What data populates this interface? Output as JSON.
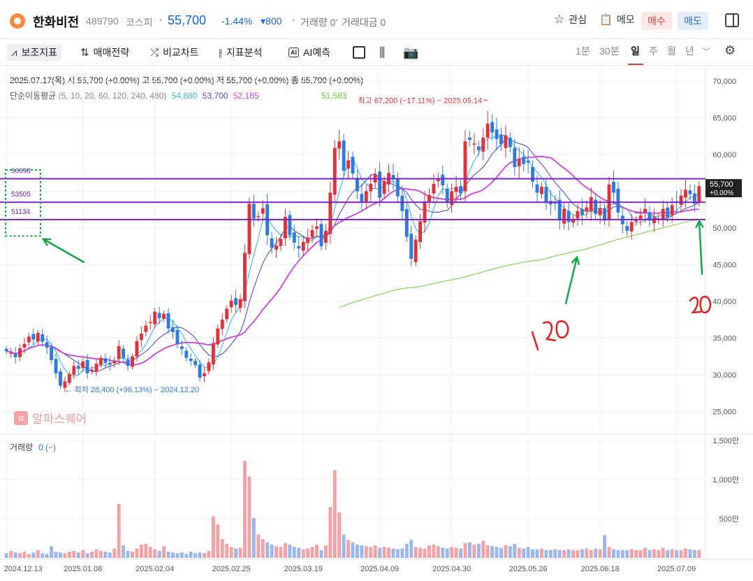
{
  "header": {
    "name": "한화비전",
    "code": "489790",
    "market": "코스피",
    "price": "55,700",
    "change_pct": "-1.44%",
    "change_amt": "▾800",
    "volume": "거래량 0",
    "turnover": "거래대금 0",
    "fav": "관심",
    "memo": "메모",
    "buy": "매수",
    "sell": "매도"
  },
  "toolbar": {
    "indicators": "보조지표",
    "strategy": "매매전략",
    "compare": "비교차트",
    "analysis": "지표분석",
    "ai_badge": "AI",
    "ai_forecast": "AI예측",
    "periods": [
      "1분",
      "30분",
      "일",
      "주",
      "월",
      "년"
    ],
    "selected_period": "일"
  },
  "info": {
    "ohlc_line": "2025.07.17(목)  시 55,700 (+0.00%)   고 55,700 (+0.00%)   저 55,700 (+0.00%)   종 55,700 (+0.00%)",
    "ma_label": "단순이동평균",
    "ma_periods": "(5, 10, 20, 60, 120, 240, 480)",
    "ma_values": [
      {
        "value": "54,880",
        "color": "#3fb7ea"
      },
      {
        "value": "53,700",
        "color": "#5151c9"
      },
      {
        "value": "52,185",
        "color": "#cc44d9"
      },
      {
        "value": "51,583",
        "color": "#70cc45"
      }
    ],
    "high_label": "최고 67,200 (−17.11%) − 2025.05.14",
    "low_label": "최저 28,400 (+96.13%) − 2024.12.20",
    "volume_label": "거래량",
    "volume_value": "0 (−)",
    "watermark": "알파스퀘어",
    "watermark_icon": "α"
  },
  "colors": {
    "up": "#e0323c",
    "down": "#2d7ae0",
    "up_volume": "#f3a3a6",
    "down_volume": "#9ab8ef",
    "ma5": "#3fb7ea",
    "ma10": "#5151c9",
    "ma20": "#cc44d9",
    "ma120": "#70cc45",
    "hline": "#7a22c9",
    "annotation_green": "#14a84a",
    "annotation_red": "#e41c1c",
    "grid": "#f0f0f0"
  },
  "chart_data": {
    "type": "candlestick",
    "ylim": [
      22000,
      72000
    ],
    "y_ticks": [
      "70,000",
      "65,000",
      "60,000",
      "55,000",
      "50,000",
      "45,000",
      "40,000",
      "35,000",
      "30,000",
      "25,000"
    ],
    "y_tick_values": [
      70000,
      65000,
      60000,
      55000,
      50000,
      45000,
      40000,
      35000,
      30000,
      25000
    ],
    "x_ticks": [
      "2024.12.13",
      "2025.01.08",
      "2025.02.04",
      "2025.02.25",
      "2025.03.19",
      "2025.04.09",
      "2025.04.30",
      "2025.05.26",
      "2025.06.18",
      "2025.07.09"
    ],
    "horizontal_lines": [
      {
        "value": 56698,
        "label": "56698"
      },
      {
        "value": 53505,
        "label": "53505"
      },
      {
        "value": 51134,
        "label": "51134"
      }
    ],
    "last_price": {
      "value": 55700,
      "label": "55,700",
      "change": "+0.00%"
    },
    "volume_ylim": [
      0,
      1500
    ],
    "volume_ticks": [
      "1,500만",
      "1,000만",
      "500만"
    ],
    "volume_tick_values": [
      1500,
      1000,
      500
    ],
    "closes": [
      33200,
      33000,
      32400,
      33600,
      34200,
      35200,
      34800,
      35700,
      34500,
      33700,
      32000,
      30200,
      28500,
      29100,
      30100,
      31200,
      30800,
      31800,
      30200,
      30700,
      31500,
      32300,
      31600,
      31400,
      31900,
      33900,
      32300,
      31200,
      32500,
      34600,
      35600,
      36700,
      37200,
      38600,
      37700,
      38300,
      36300,
      35800,
      34200,
      33500,
      32300,
      31900,
      31300,
      29600,
      30200,
      31700,
      34300,
      36300,
      37500,
      39000,
      40100,
      39500,
      40300,
      46600,
      53300,
      51300,
      51600,
      52700,
      49000,
      47300,
      47600,
      48500,
      51500,
      49000,
      48000,
      47200,
      48100,
      48700,
      49700,
      50200,
      47500,
      49600,
      54800,
      60900,
      61800,
      57800,
      59200,
      57400,
      55000,
      53600,
      55000,
      56000,
      57300,
      54100,
      56400,
      57500,
      56700,
      54300,
      52300,
      48800,
      45800,
      48400,
      50900,
      53600,
      54500,
      56000,
      56700,
      55800,
      53400,
      55000,
      55600,
      54700,
      61800,
      62000,
      61500,
      60600,
      62300,
      64200,
      63000,
      62100,
      61400,
      62600,
      61000,
      58300,
      59400,
      58700,
      58900,
      56300,
      54800,
      55600,
      53500,
      53200,
      53300,
      51000,
      52600,
      50800,
      51200,
      52300,
      51800,
      52800,
      54200,
      51900,
      52700,
      51000,
      55900,
      54800,
      52100,
      50500,
      49600,
      50800,
      51000,
      51700,
      52600,
      51000,
      51400,
      51300,
      52600,
      51400,
      53100,
      53600,
      54400,
      55200,
      54600,
      53300,
      55700
    ],
    "volumes": [
      60,
      90,
      70,
      60,
      80,
      50,
      70,
      100,
      60,
      50,
      150,
      80,
      70,
      60,
      80,
      90,
      70,
      100,
      60,
      80,
      110,
      90,
      80,
      70,
      120,
      690,
      160,
      90,
      80,
      120,
      170,
      180,
      140,
      110,
      90,
      150,
      80,
      70,
      60,
      70,
      50,
      80,
      60,
      70,
      60,
      90,
      530,
      430,
      240,
      180,
      140,
      120,
      130,
      1240,
      1040,
      510,
      300,
      240,
      200,
      170,
      150,
      140,
      190,
      170,
      140,
      130,
      110,
      120,
      140,
      170,
      100,
      160,
      650,
      1120,
      580,
      300,
      230,
      200,
      170,
      160,
      150,
      140,
      160,
      130,
      140,
      130,
      120,
      110,
      120,
      180,
      230,
      140,
      130,
      120,
      160,
      170,
      150,
      130,
      120,
      140,
      130,
      120,
      190,
      200,
      170,
      180,
      220,
      160,
      150,
      140,
      130,
      160,
      150,
      180,
      130,
      120,
      140,
      110,
      110,
      120,
      100,
      100,
      110,
      100,
      100,
      110,
      100,
      100,
      110,
      120,
      100,
      120,
      110,
      290,
      140,
      110,
      100,
      100,
      100,
      110,
      100,
      100,
      130,
      100,
      110,
      100,
      130,
      100,
      110,
      100,
      100,
      120,
      110,
      100,
      100
    ]
  }
}
